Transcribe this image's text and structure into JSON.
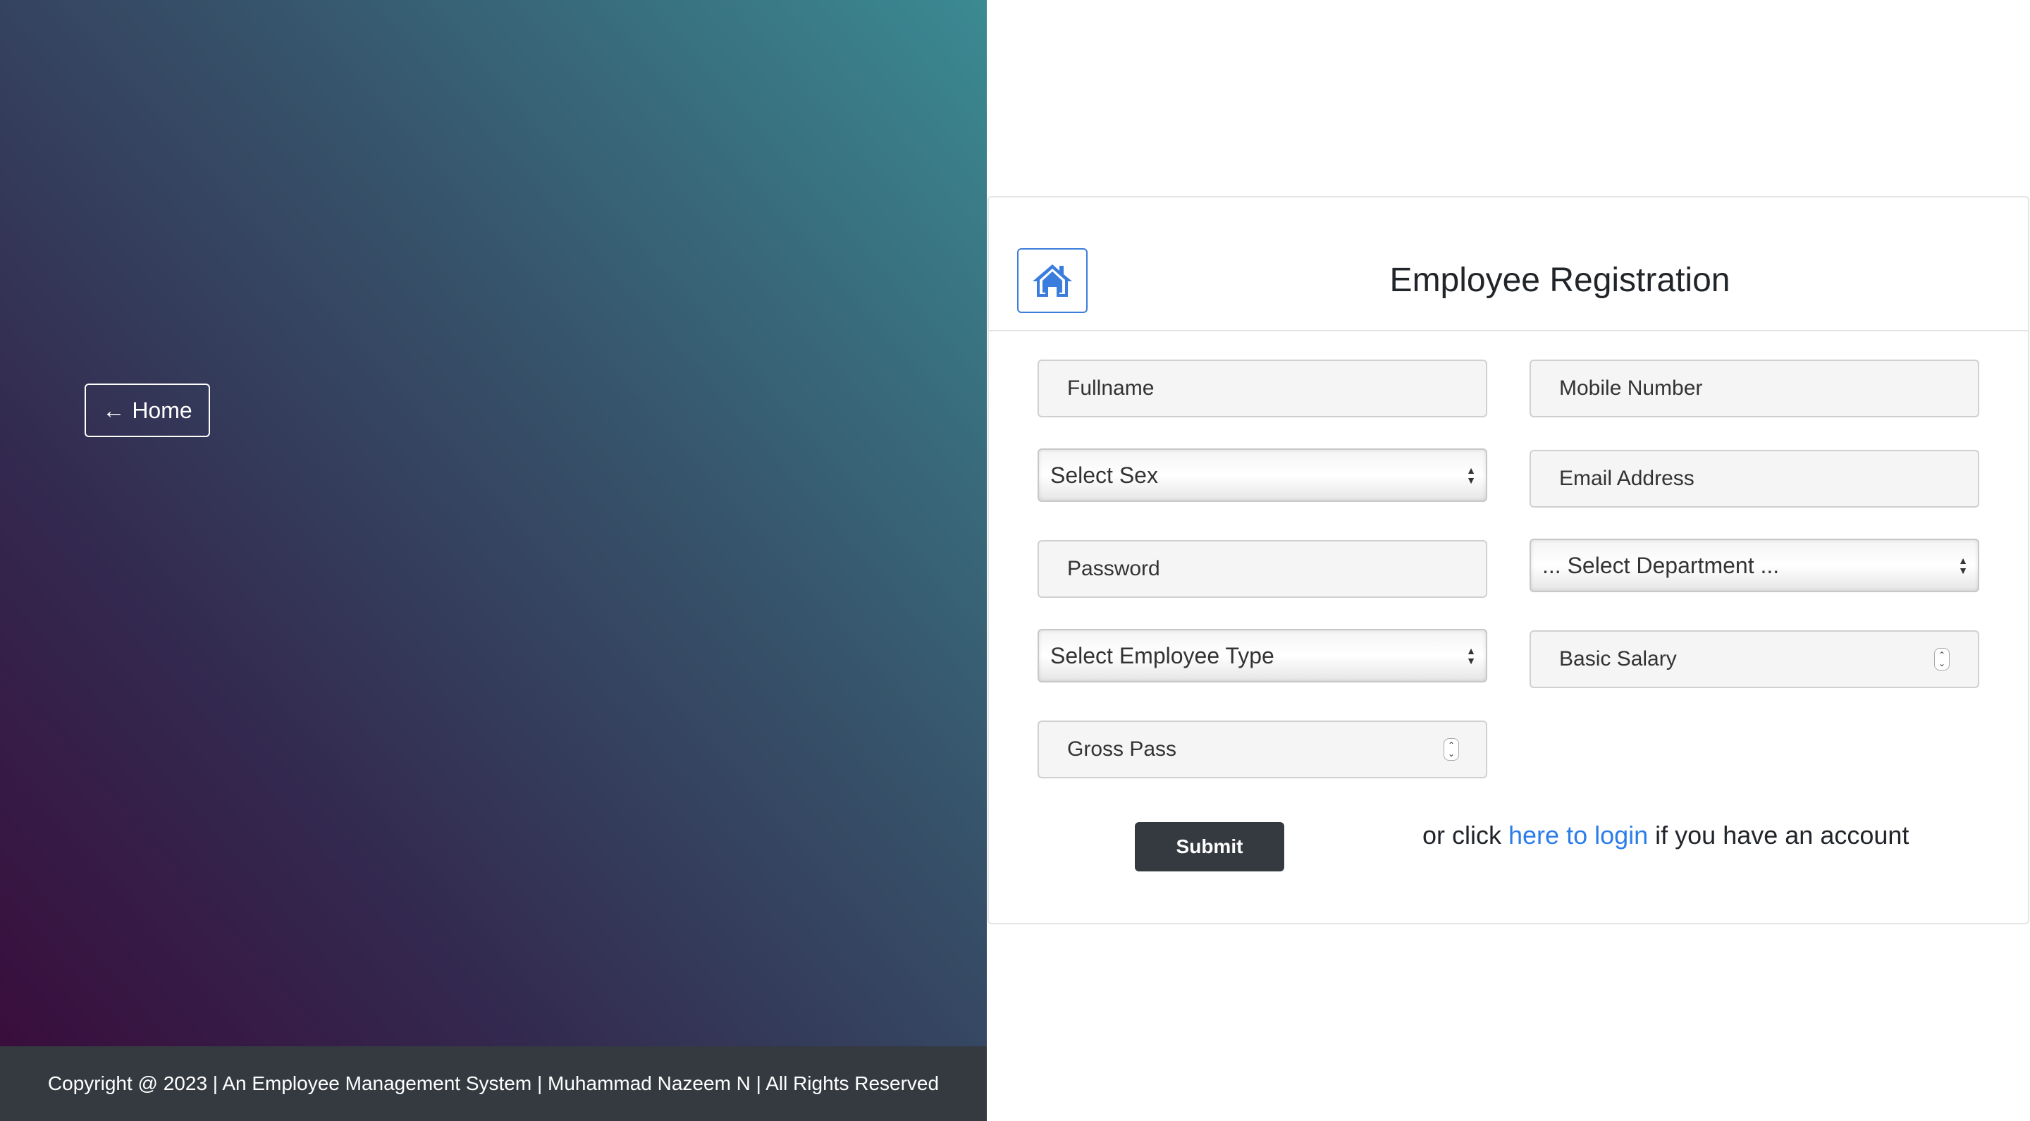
{
  "left": {
    "home_button": {
      "arrow": "←",
      "label": "Home"
    },
    "footer": {
      "text": "Copyright @ 2023 | An Employee Management System | Muhammad Nazeem N | All Rights Reserved"
    }
  },
  "form": {
    "title": "Employee Registration",
    "home_icon": "house-icon",
    "fields": {
      "fullname": "Fullname",
      "mobile": "Mobile Number",
      "sex": "Select Sex",
      "email": "Email Address",
      "password": "Password",
      "department": "... Select Department ...",
      "employee_type": "Select Employee Type",
      "basic_salary": "Basic Salary",
      "gross_pass": "Gross Pass"
    },
    "submit_label": "Submit",
    "login_prefix": "or click ",
    "login_link": "here to login",
    "login_suffix": " if you have an account"
  },
  "colors": {
    "accent": "#2b7de9",
    "dark": "#343a40"
  }
}
